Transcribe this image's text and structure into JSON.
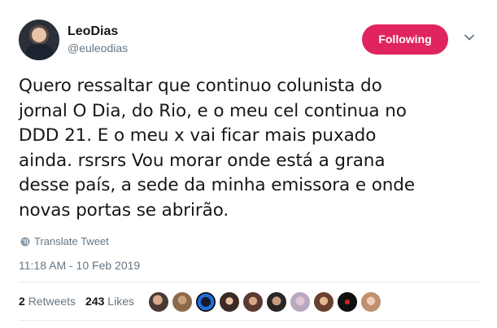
{
  "user": {
    "display_name": "LeoDias",
    "handle": "@euleodias"
  },
  "follow_button_label": "Following",
  "tweet": {
    "lines": [
      "Quero ressaltar que continuo colunista do",
      "jornal O Dia, do Rio, e o meu cel continua no",
      "DDD 21. E o meu x vai ficar mais puxado",
      "ainda. rsrsrs Vou morar onde está a grana",
      "desse país, a sede da minha emissora e onde",
      "novas portas se abrirão."
    ]
  },
  "translate_label": "Translate Tweet",
  "timestamp": "11:18 AM - 10 Feb 2019",
  "stats": {
    "retweets_count": "2",
    "retweets_label": "Retweets",
    "likes_count": "243",
    "likes_label": "Likes"
  },
  "icons": [
    "chevron-down-icon",
    "globe-icon"
  ],
  "colors": {
    "follow_button": "#e0245e",
    "secondary_text": "#657786",
    "primary_text": "#14171a",
    "divider": "#e6ecf0"
  }
}
